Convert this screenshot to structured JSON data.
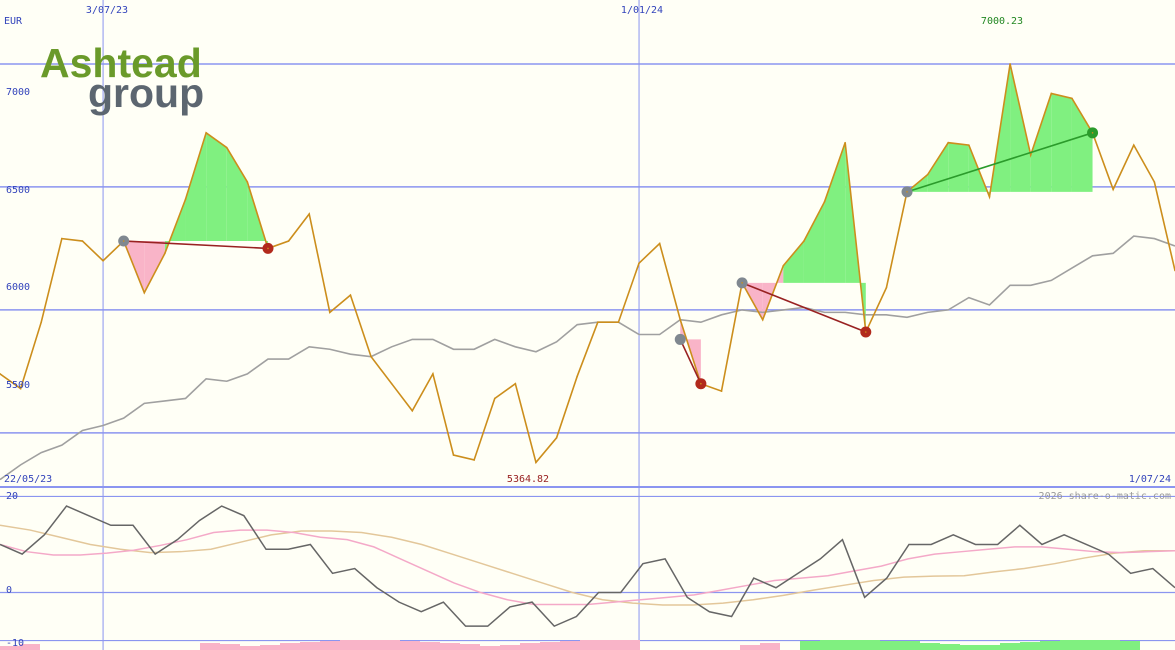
{
  "chart_data": [
    {
      "type": "line",
      "currency": "EUR",
      "date_start": "22/05/23",
      "date_end": "1/07/24",
      "x_ticks": [
        "3/07/23",
        "1/01/24"
      ],
      "y_ticks": [
        5500,
        6000,
        6500,
        7000
      ],
      "ylim": [
        5280,
        7260
      ],
      "max_label": "7000.23",
      "min_label": "5364.82",
      "colors": {
        "price": "#cc8e1c",
        "avg": "#a0a0a0",
        "grid": "#8b95f0",
        "gain": "#80f080",
        "loss": "#f9b4c8",
        "gain_line": "#2b9b2b",
        "loss_line": "#992222"
      },
      "series": [
        {
          "key": "price",
          "values": [
            5740,
            5680,
            5950,
            6290,
            6280,
            6200,
            6280,
            6070,
            6230,
            6450,
            6720,
            6660,
            6520,
            6250,
            6280,
            6390,
            5990,
            6060,
            5810,
            5700,
            5590,
            5740,
            5410,
            5390,
            5640,
            5700,
            5380,
            5480,
            5730,
            5950,
            5950,
            6190,
            6270,
            5960,
            5700,
            5670,
            6110,
            5960,
            6180,
            6280,
            6440,
            6680,
            5910,
            6090,
            6480,
            6550,
            6680,
            6670,
            6460,
            7000,
            6630,
            6880,
            6860,
            6720,
            6490,
            6670,
            6520,
            6160
          ]
        },
        {
          "key": "avg",
          "values": [
            5310,
            5370,
            5420,
            5450,
            5510,
            5530,
            5560,
            5620,
            5630,
            5640,
            5720,
            5710,
            5740,
            5800,
            5800,
            5850,
            5840,
            5820,
            5810,
            5850,
            5880,
            5880,
            5840,
            5840,
            5880,
            5850,
            5830,
            5870,
            5940,
            5950,
            5950,
            5900,
            5900,
            5960,
            5950,
            5980,
            6000,
            5990,
            6000,
            6010,
            5990,
            5990,
            5980,
            5980,
            5970,
            5990,
            6000,
            6050,
            6020,
            6100,
            6100,
            6120,
            6170,
            6220,
            6230,
            6300,
            6290,
            6260
          ]
        }
      ],
      "trades": [
        {
          "type": "loss",
          "entry": {
            "i": 6,
            "value": 6280
          },
          "exit": {
            "i": 13,
            "value": 6250
          }
        },
        {
          "type": "loss",
          "entry": {
            "i": 33,
            "value": 5880
          },
          "exit": {
            "i": 34,
            "value": 5700
          }
        },
        {
          "type": "loss",
          "entry": {
            "i": 36,
            "value": 6110
          },
          "exit": {
            "i": 42,
            "value": 5910
          }
        },
        {
          "type": "gain",
          "entry": {
            "i": 44,
            "value": 6480
          },
          "exit": {
            "i": 53,
            "value": 6720
          }
        }
      ]
    },
    {
      "type": "line",
      "y_ticks": [
        20,
        0,
        -10
      ],
      "ylim": [
        -10.3,
        20.3
      ],
      "series": [
        {
          "key": "momentum",
          "values": [
            10,
            8,
            12,
            18,
            16,
            14,
            14,
            8,
            11,
            15,
            18,
            16,
            9,
            9,
            10,
            4,
            5,
            1,
            -2,
            -4,
            -2,
            -7,
            -7,
            -3,
            -2,
            -7,
            -5,
            0,
            0,
            6,
            7,
            -1,
            -4,
            -5,
            3,
            1,
            4,
            7,
            11,
            -1,
            3,
            10,
            10,
            12,
            10,
            10,
            14,
            10,
            12,
            10,
            8,
            4,
            5,
            1
          ]
        },
        {
          "key": "signal",
          "values": [
            10,
            8.5,
            7.8,
            7.8,
            8.2,
            8.8,
            9.8,
            11,
            12.5,
            13,
            13,
            12.5,
            11.5,
            11,
            9.5,
            7,
            4.5,
            2,
            0,
            -1.5,
            -2.5,
            -2.5,
            -2.5,
            -2,
            -1.5,
            -1,
            -0.5,
            0.5,
            1.5,
            2.5,
            3,
            3.5,
            4.5,
            5.5,
            7,
            8,
            8.5,
            9,
            9.5,
            9.5,
            9,
            8.5,
            8.3,
            8.5,
            8.7
          ]
        },
        {
          "key": "smooth",
          "values": [
            14,
            13,
            11.5,
            10,
            9,
            8.3,
            8.5,
            9,
            10.5,
            12,
            12.8,
            12.8,
            12.5,
            11.5,
            10,
            8,
            6,
            4,
            2,
            0,
            -1.5,
            -2.2,
            -2.6,
            -2.6,
            -2.2,
            -1.5,
            -0.6,
            0.5,
            1.5,
            2.5,
            3.2,
            3.4,
            3.5,
            4.3,
            5,
            6,
            7.2,
            8.2,
            8.7,
            8.7
          ]
        }
      ],
      "colors": {
        "momentum": "#666666",
        "signal": "#f4a9c8",
        "smooth": "#e3c79a",
        "volume_loss": "#f9b4c8",
        "volume_gain": "#80f080"
      }
    }
  ],
  "watermark": "2026 share-o-matic.com",
  "logo": {
    "line1": "Ashtead",
    "line2": "group"
  }
}
